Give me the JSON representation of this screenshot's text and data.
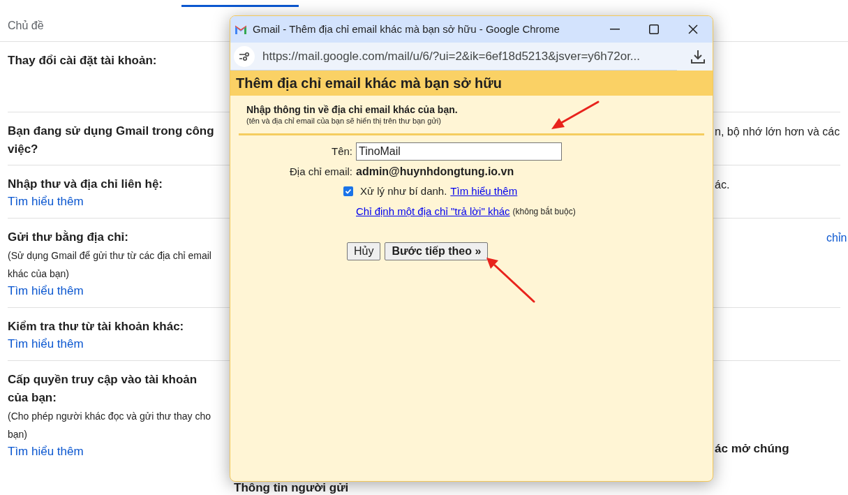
{
  "section_label": "Chủ đề",
  "settings_rows": [
    {
      "title": "Thay đổi cài đặt tài khoản:"
    },
    {
      "title": "Bạn đang sử dụng Gmail trong công việc?",
      "right": {
        "text": "n, bộ nhớ lớn hơn và các",
        "kind": "text"
      }
    },
    {
      "title": "Nhập thư và địa chỉ liên hệ:",
      "link": "Tìm hiểu thêm",
      "right": {
        "text": "ác.",
        "kind": "text"
      }
    },
    {
      "title": "Gửi thư bằng địa chỉ:",
      "description": "(Sử dụng Gmail để gửi thư từ các địa chỉ email khác của bạn)",
      "link": "Tìm hiểu thêm",
      "right": {
        "text": "chỉn",
        "kind": "link"
      }
    },
    {
      "title": "Kiểm tra thư từ tài khoản khác:",
      "link": "Tìm hiểu thêm"
    },
    {
      "title": "Cấp quyền truy cập vào tài khoản của bạn:",
      "description": "(Cho phép người khác đọc và gửi thư thay cho bạn)",
      "link": "Tìm hiểu thêm",
      "right": {
        "text": "ác mở chúng",
        "kind": "bold"
      }
    }
  ],
  "next_section_title": "Thông tin người gửi",
  "popup": {
    "window_title": "Gmail - Thêm địa chỉ email khác mà bạn sở hữu - Google Chrome",
    "url": "https://mail.google.com/mail/u/6/?ui=2&ik=6ef18d5213&jsver=y6h72or...",
    "dialog_title": "Thêm địa chỉ email khác mà bạn sở hữu",
    "heading": "Nhập thông tin về địa chỉ email khác của bạn.",
    "subheading": "(tên và địa chỉ email của bạn sẽ hiển thị trên thư bạn gửi)",
    "name_label": "Tên:",
    "name_value": "TinoMail",
    "email_label": "Địa chỉ email:",
    "email_value": "admin@huynhdongtung.io.vn",
    "alias": {
      "checked": true,
      "label": "Xử lý như bí danh.",
      "link": "Tìm hiểu thêm"
    },
    "reply_link": "Chỉ định một địa chỉ \"trả lời\" khác",
    "reply_note": "(không bắt buộc)",
    "buttons": [
      {
        "label": "Hủy",
        "kind": "normal"
      },
      {
        "label": "Bước tiếp theo »",
        "kind": "primary"
      }
    ]
  }
}
